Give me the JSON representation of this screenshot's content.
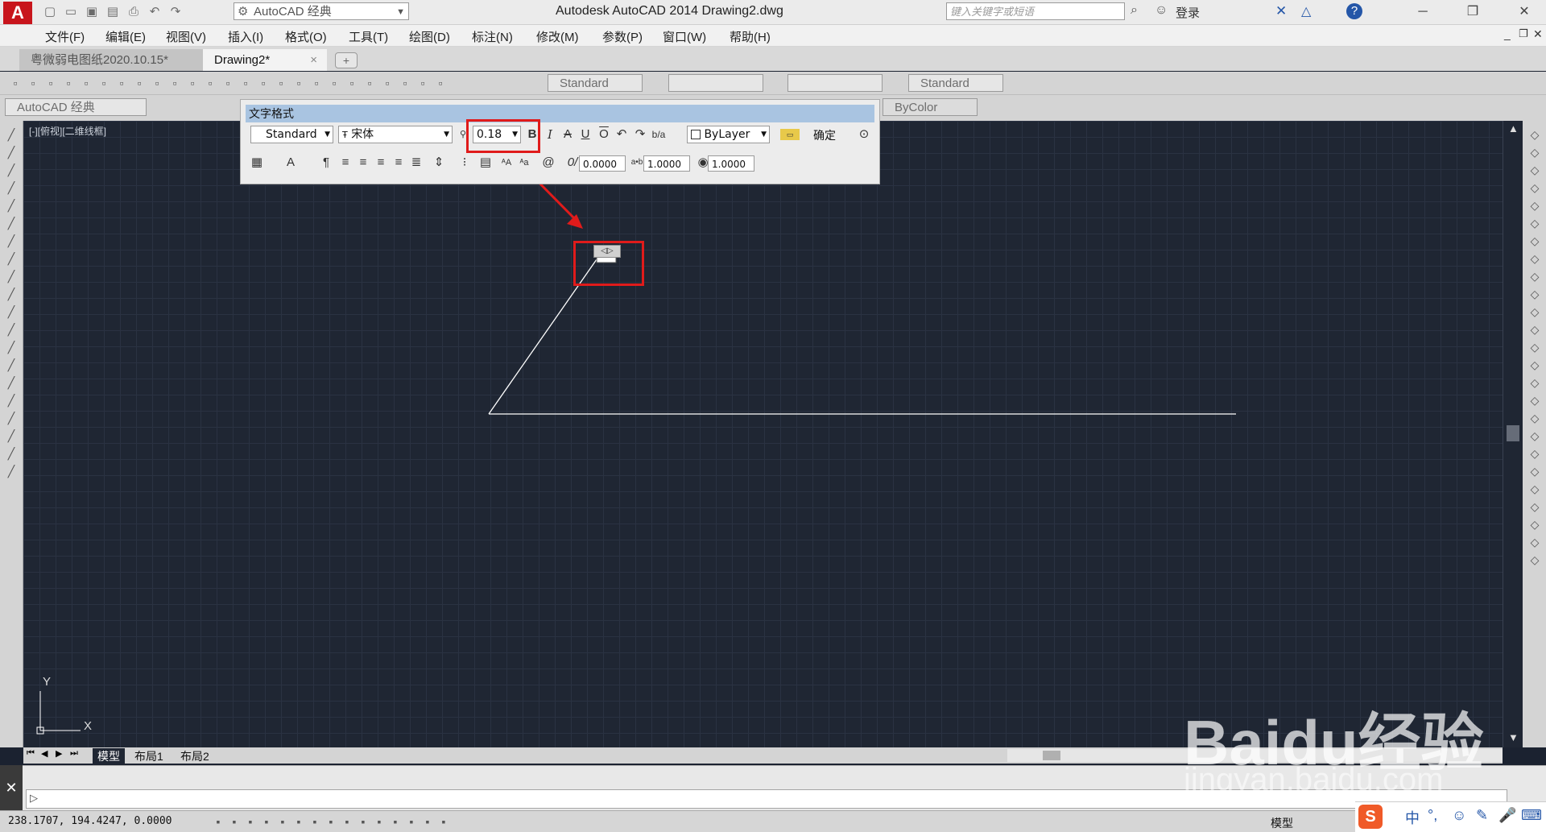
{
  "app": {
    "title": "Autodesk AutoCAD 2014    Drawing2.dwg",
    "workspace": "AutoCAD 经典",
    "search_placeholder": "键入关键字或短语",
    "login": "登录",
    "help": "?"
  },
  "menu": [
    "文件(F)",
    "编辑(E)",
    "视图(V)",
    "插入(I)",
    "格式(O)",
    "工具(T)",
    "绘图(D)",
    "标注(N)",
    "修改(M)",
    "参数(P)",
    "窗口(W)",
    "帮助(H)"
  ],
  "doc_tabs": [
    {
      "label": "粤微弱电图纸2020.10.15*"
    },
    {
      "label": "Drawing2*"
    }
  ],
  "toolbar": {
    "text_style": "Standard",
    "dim_style": "Standard",
    "workspace2": "AutoCAD 经典",
    "color": "ByColor"
  },
  "viewport_label": "[-][俯视][二维线框]",
  "text_format": {
    "title": "文字格式",
    "style": "Standard",
    "font": "宋体",
    "height": "0.18",
    "color": "ByLayer",
    "ok": "确定",
    "oblique": "0.0000",
    "tracking": "1.0000",
    "width": "1.0000"
  },
  "ucs": {
    "x": "X",
    "y": "Y"
  },
  "layout_tabs": [
    "模型",
    "布局1",
    "布局2"
  ],
  "status": {
    "coords": "238.1707, 194.4247, 0.0000",
    "model": "模型"
  },
  "ime": {
    "lang": "中"
  },
  "watermark": {
    "main": "Baidu经验",
    "sub": "jingyan.baidu.com"
  }
}
